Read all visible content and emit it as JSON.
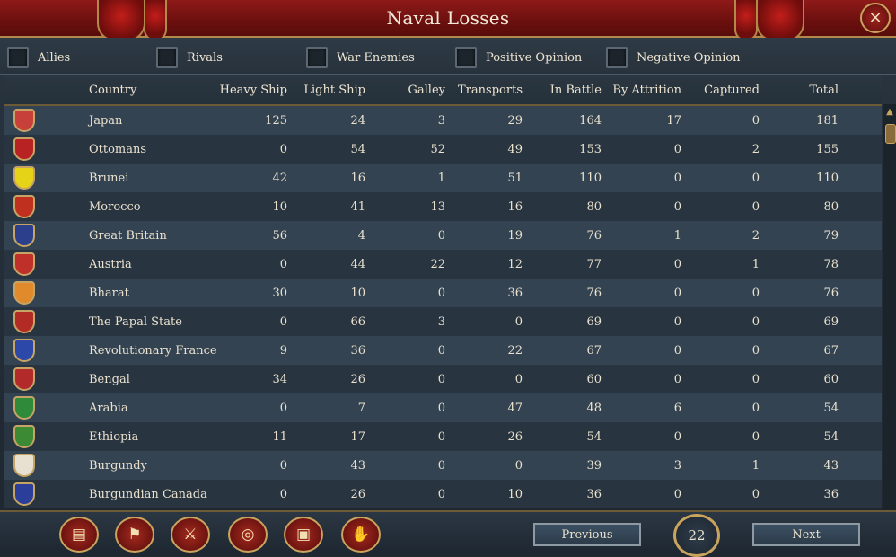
{
  "window": {
    "title": "Naval Losses",
    "close_symbol": "×"
  },
  "filters": [
    {
      "label": "Allies"
    },
    {
      "label": "Rivals"
    },
    {
      "label": "War Enemies"
    },
    {
      "label": "Positive Opinion"
    },
    {
      "label": "Negative Opinion"
    }
  ],
  "table": {
    "headers": {
      "country": "Country",
      "heavy": "Heavy Ship",
      "light": "Light Ship",
      "galley": "Galley",
      "transports": "Transports",
      "in_battle": "In Battle",
      "attrition": "By Attrition",
      "captured": "Captured",
      "total": "Total"
    },
    "rows": [
      {
        "country": "Japan",
        "heavy": "125",
        "light": "24",
        "galley": "3",
        "transports": "29",
        "in_battle": "164",
        "attrition": "17",
        "captured": "0",
        "total": "181",
        "flag_color": "#c8403a"
      },
      {
        "country": "Ottomans",
        "heavy": "0",
        "light": "54",
        "galley": "52",
        "transports": "49",
        "in_battle": "153",
        "attrition": "0",
        "captured": "2",
        "total": "155",
        "flag_color": "#b82222"
      },
      {
        "country": "Brunei",
        "heavy": "42",
        "light": "16",
        "galley": "1",
        "transports": "51",
        "in_battle": "110",
        "attrition": "0",
        "captured": "0",
        "total": "110",
        "flag_color": "#e5d318"
      },
      {
        "country": "Morocco",
        "heavy": "10",
        "light": "41",
        "galley": "13",
        "transports": "16",
        "in_battle": "80",
        "attrition": "0",
        "captured": "0",
        "total": "80",
        "flag_color": "#c0301e"
      },
      {
        "country": "Great Britain",
        "heavy": "56",
        "light": "4",
        "galley": "0",
        "transports": "19",
        "in_battle": "76",
        "attrition": "1",
        "captured": "2",
        "total": "79",
        "flag_color": "#2c3f8c"
      },
      {
        "country": "Austria",
        "heavy": "0",
        "light": "44",
        "galley": "22",
        "transports": "12",
        "in_battle": "77",
        "attrition": "0",
        "captured": "1",
        "total": "78",
        "flag_color": "#c0302a"
      },
      {
        "country": "Bharat",
        "heavy": "30",
        "light": "10",
        "galley": "0",
        "transports": "36",
        "in_battle": "76",
        "attrition": "0",
        "captured": "0",
        "total": "76",
        "flag_color": "#e08a2c"
      },
      {
        "country": "The Papal State",
        "heavy": "0",
        "light": "66",
        "galley": "3",
        "transports": "0",
        "in_battle": "69",
        "attrition": "0",
        "captured": "0",
        "total": "69",
        "flag_color": "#b22b24"
      },
      {
        "country": "Revolutionary France",
        "heavy": "9",
        "light": "36",
        "galley": "0",
        "transports": "22",
        "in_battle": "67",
        "attrition": "0",
        "captured": "0",
        "total": "67",
        "flag_color": "#2c48a8"
      },
      {
        "country": "Bengal",
        "heavy": "34",
        "light": "26",
        "galley": "0",
        "transports": "0",
        "in_battle": "60",
        "attrition": "0",
        "captured": "0",
        "total": "60",
        "flag_color": "#b22a2a"
      },
      {
        "country": "Arabia",
        "heavy": "0",
        "light": "7",
        "galley": "0",
        "transports": "47",
        "in_battle": "48",
        "attrition": "6",
        "captured": "0",
        "total": "54",
        "flag_color": "#2f8a3a"
      },
      {
        "country": "Ethiopia",
        "heavy": "11",
        "light": "17",
        "galley": "0",
        "transports": "26",
        "in_battle": "54",
        "attrition": "0",
        "captured": "0",
        "total": "54",
        "flag_color": "#3d8a34"
      },
      {
        "country": "Burgundy",
        "heavy": "0",
        "light": "43",
        "galley": "0",
        "transports": "0",
        "in_battle": "39",
        "attrition": "3",
        "captured": "1",
        "total": "43",
        "flag_color": "#e8e0d0"
      },
      {
        "country": "Burgundian Canada",
        "heavy": "0",
        "light": "26",
        "galley": "0",
        "transports": "10",
        "in_battle": "36",
        "attrition": "0",
        "captured": "0",
        "total": "36",
        "flag_color": "#2b3f9a"
      }
    ]
  },
  "bottom": {
    "tabs": [
      {
        "icon": "ledger-icon",
        "glyph": "▤"
      },
      {
        "icon": "flags-icon",
        "glyph": "⚑"
      },
      {
        "icon": "crossed-swords-icon",
        "glyph": "⚔"
      },
      {
        "icon": "coins-icon",
        "glyph": "◎"
      },
      {
        "icon": "crate-icon",
        "glyph": "▣"
      },
      {
        "icon": "handshake-icon",
        "glyph": "✋"
      }
    ],
    "previous_label": "Previous",
    "next_label": "Next",
    "page": "22"
  }
}
